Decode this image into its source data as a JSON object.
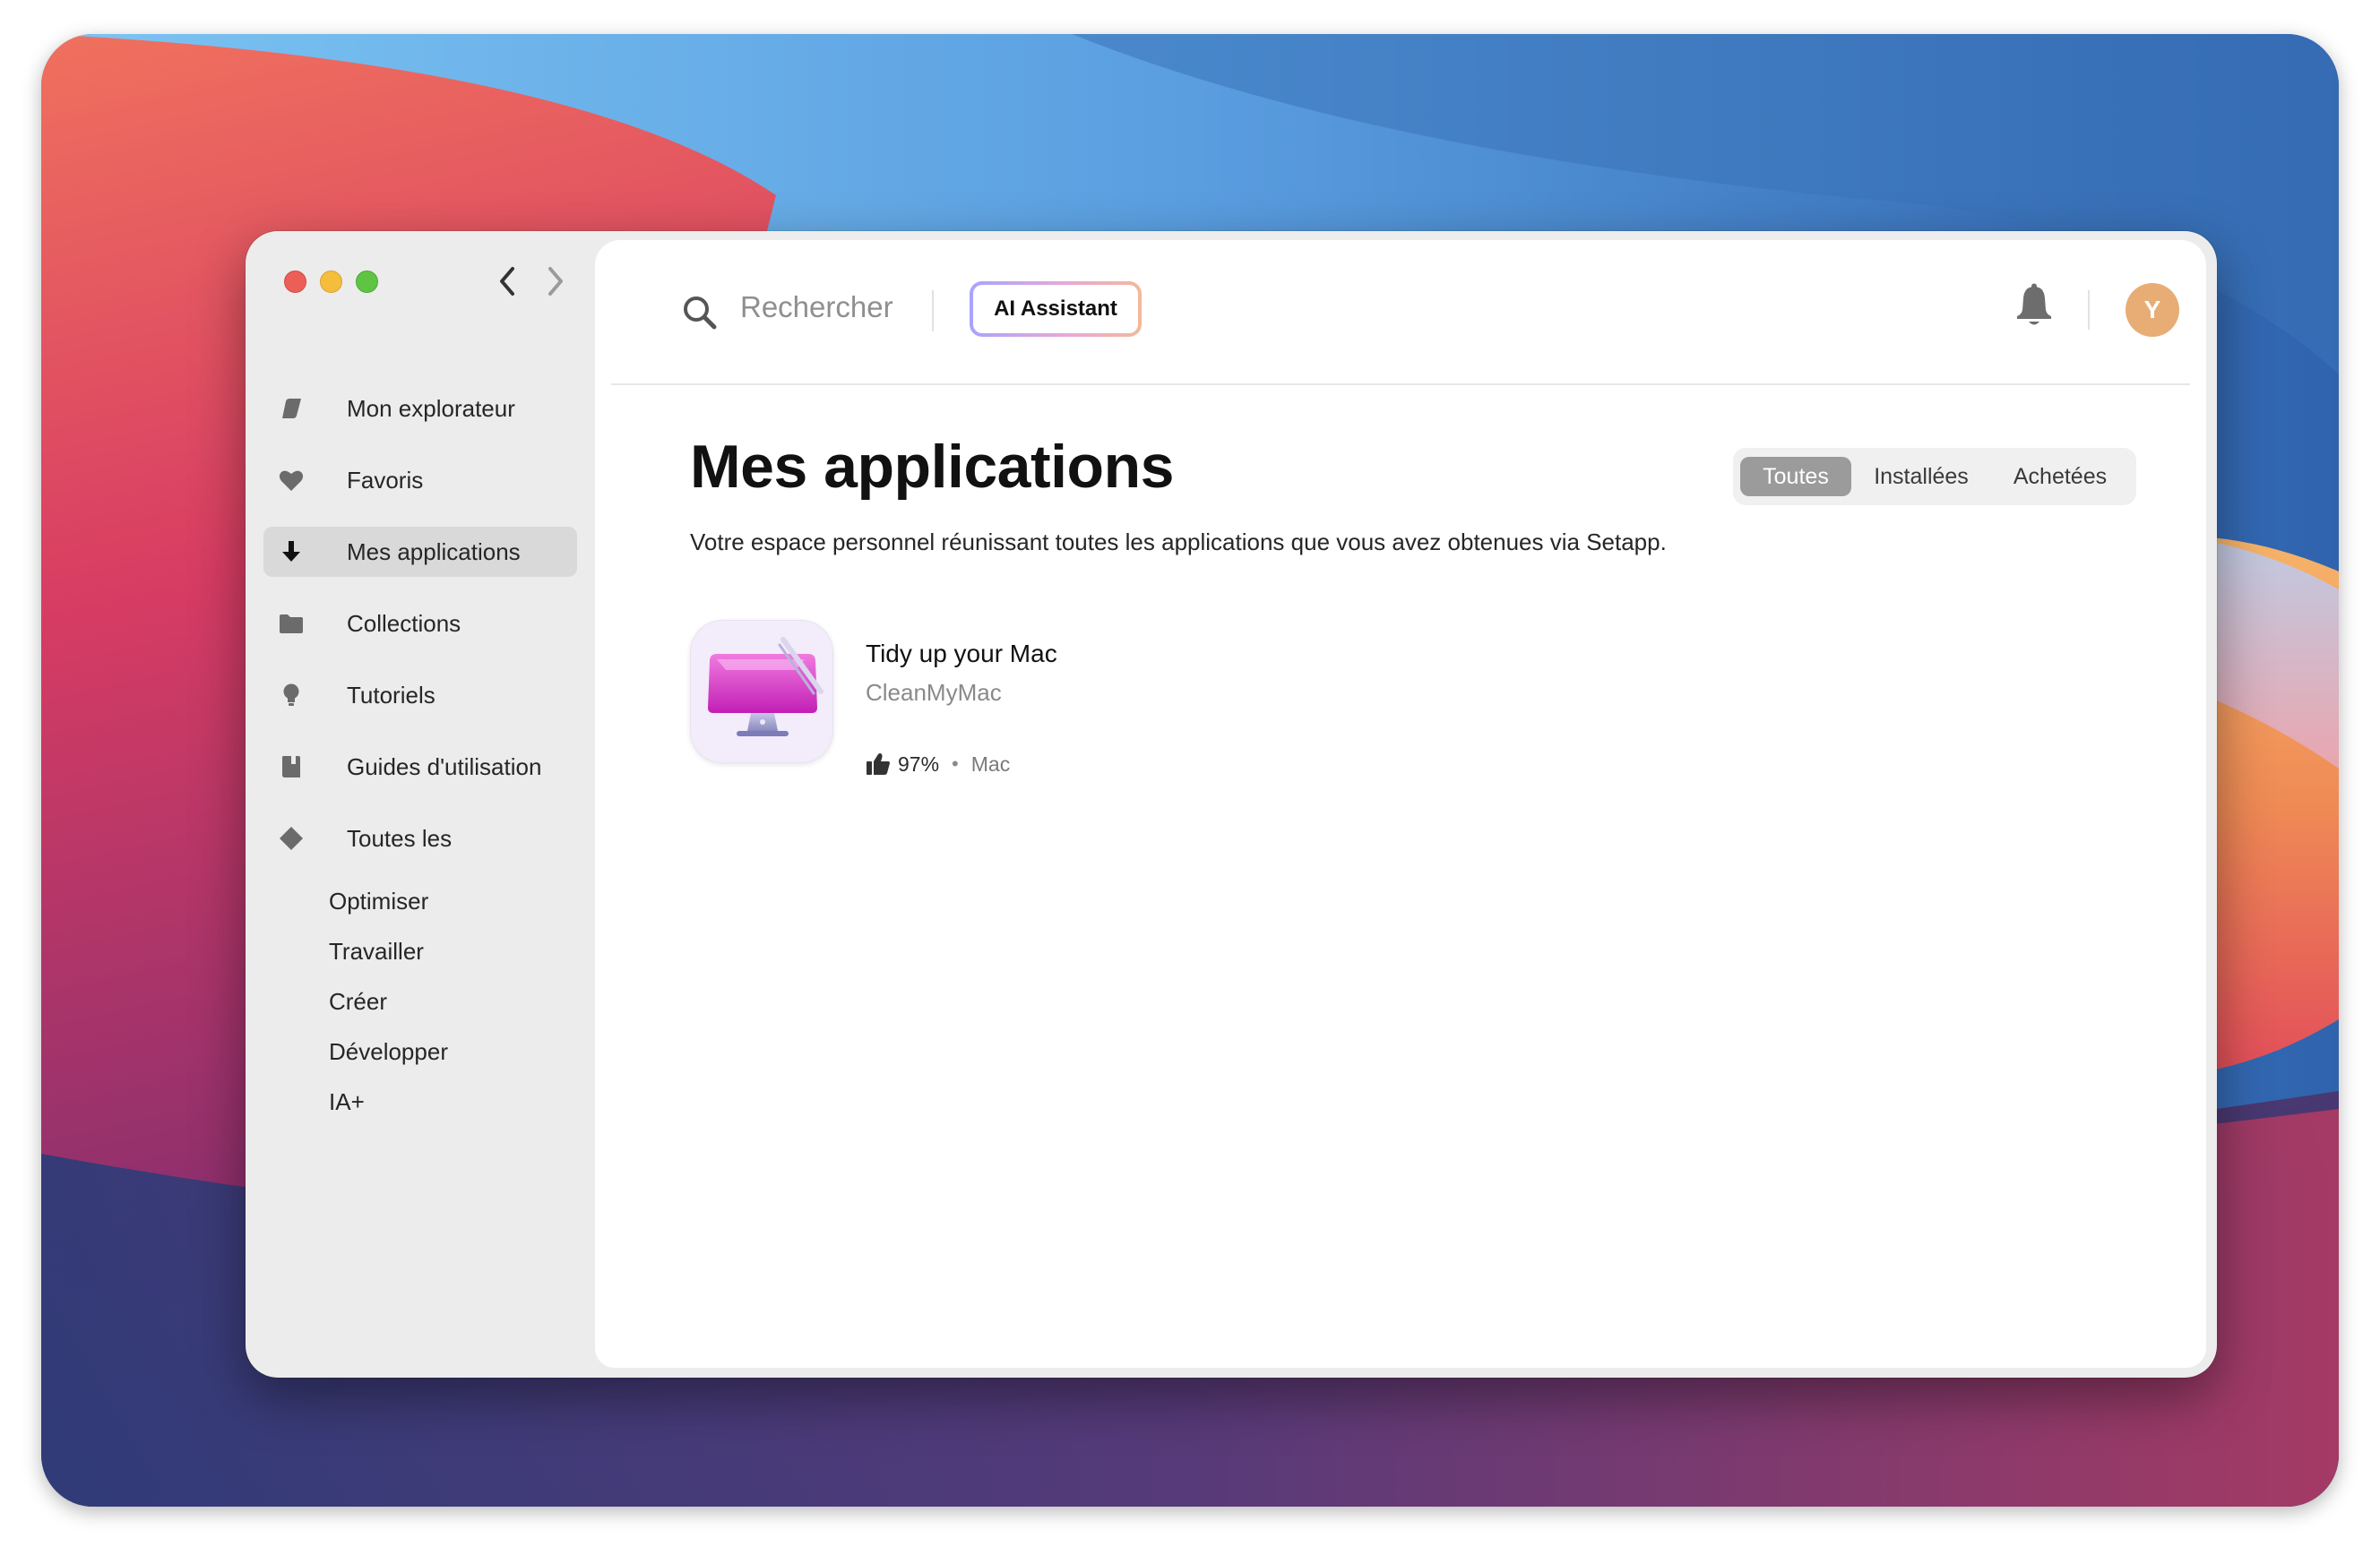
{
  "colors": {
    "accent_avatar": "#e7ad75",
    "sidebar_background": "#ececec",
    "active_item_background": "#d9d9d9",
    "segment_active": "#9b9b9b"
  },
  "window_controls": {
    "close": "close-icon",
    "minimize": "minimize-icon",
    "zoom": "zoom-icon",
    "back": "chevron-left-icon",
    "forward": "chevron-right-icon"
  },
  "sidebar": {
    "items": [
      {
        "label": "Mon explorateur",
        "icon": "compass-leaf-icon",
        "active": false
      },
      {
        "label": "Favoris",
        "icon": "heart-icon",
        "active": false
      },
      {
        "label": "Mes applications",
        "icon": "download-arrow-icon",
        "active": true
      },
      {
        "label": "Collections",
        "icon": "folder-icon",
        "active": false
      },
      {
        "label": "Tutoriels",
        "icon": "lightbulb-icon",
        "active": false
      },
      {
        "label": "Guides d'utilisation",
        "icon": "book-icon",
        "active": false
      },
      {
        "label": "Toutes les",
        "icon": "diamond-icon",
        "active": false
      }
    ],
    "categories": [
      "Optimiser",
      "Travailler",
      "Créer",
      "Développer",
      "IA+"
    ]
  },
  "header": {
    "search_placeholder": "Rechercher",
    "ai_button": "AI Assistant",
    "avatar_initial": "Y",
    "bell_icon": "bell-icon"
  },
  "main": {
    "title": "Mes applications",
    "subtitle": "Votre espace personnel réunissant toutes les applications que vous avez obtenues via Setapp.",
    "filters": [
      {
        "label": "Toutes",
        "active": true
      },
      {
        "label": "Installées",
        "active": false
      },
      {
        "label": "Achetées",
        "active": false
      }
    ],
    "apps": [
      {
        "tagline": "Tidy up your Mac",
        "name": "CleanMyMac",
        "rating": "97%",
        "separator": "•",
        "platform": "Mac",
        "icon": "cleanmymac-app-icon"
      }
    ]
  }
}
